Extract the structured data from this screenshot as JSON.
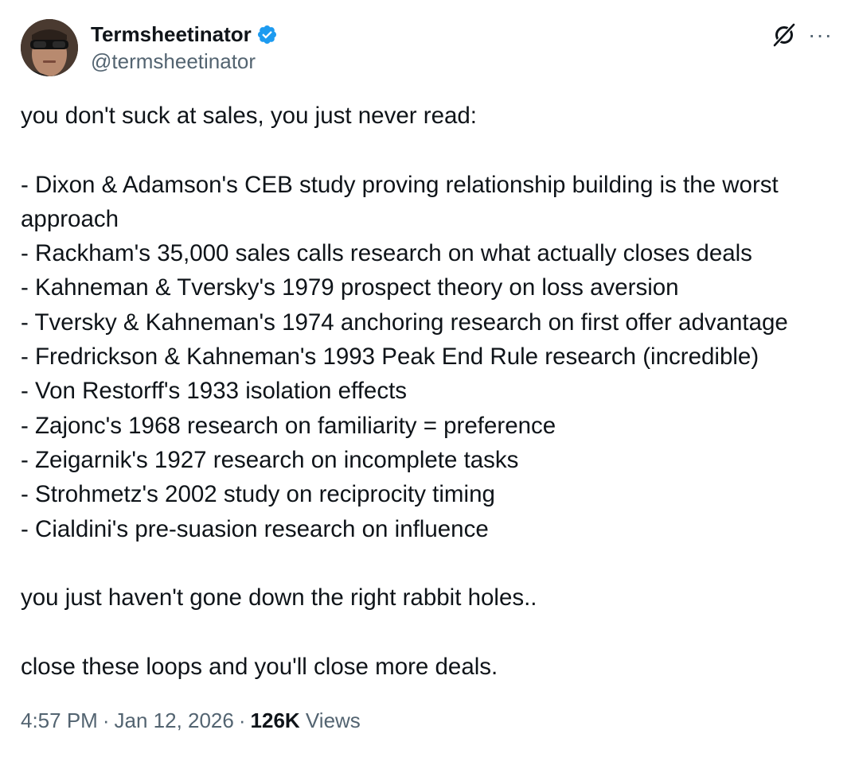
{
  "author": {
    "display_name": "Termsheetinator",
    "handle": "@termsheetinator",
    "verified": true
  },
  "icons": {
    "avatar": "profile-photo",
    "verified": "verified-badge-icon",
    "grok": "grok-icon",
    "more": "more-options-icon"
  },
  "tweet": {
    "intro": "you don't suck at sales, you just never read:",
    "list": [
      "- Dixon & Adamson's CEB study proving relationship building is the worst approach",
      "- Rackham's 35,000 sales calls research on what actually closes deals",
      "- Kahneman & Tversky's 1979 prospect theory on loss aversion",
      "- Tversky & Kahneman's 1974 anchoring research on first offer advantage",
      "- Fredrickson & Kahneman's 1993 Peak End Rule research (incredible)",
      "- Von Restorff's 1933 isolation effects",
      "- Zajonc's 1968 research on familiarity = preference",
      "- Zeigarnik's 1927 research on incomplete tasks",
      "- Strohmetz's 2002 study on reciprocity timing",
      "- Cialdini's pre-suasion research on influence"
    ],
    "line_rabbit": "you just haven't gone down the right rabbit holes..",
    "line_close": "close these loops and you'll close more deals."
  },
  "meta": {
    "time": "4:57 PM",
    "separator": "·",
    "date": "Jan 12, 2026",
    "views_count": "126K",
    "views_label": "Views"
  },
  "colors": {
    "text_primary": "#0f1419",
    "text_secondary": "#536471",
    "verified_blue": "#1d9bf0",
    "background": "#ffffff"
  }
}
